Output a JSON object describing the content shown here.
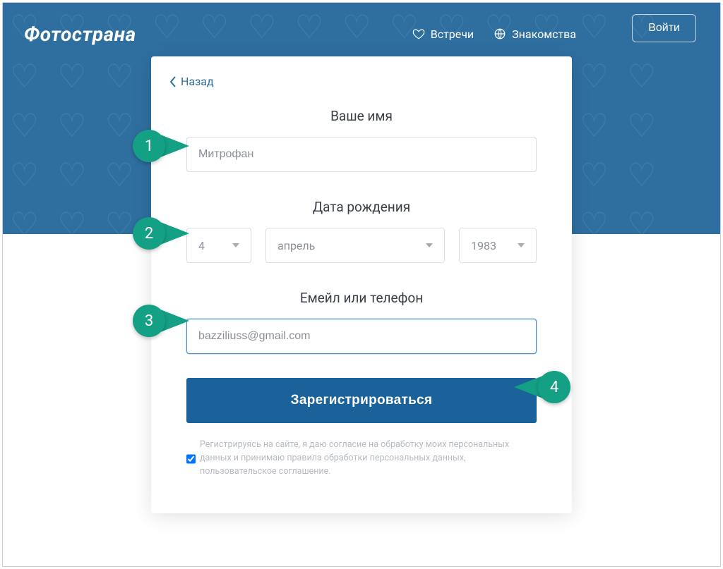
{
  "brand": "Фотострана",
  "nav": {
    "meet": "Встречи",
    "dating": "Знакомства"
  },
  "login_label": "Войти",
  "back_label": "Назад",
  "form": {
    "name_label": "Ваше имя",
    "name_value": "Митрофан",
    "dob_label": "Дата рождения",
    "day": "4",
    "month": "апрель",
    "year": "1983",
    "contact_label": "Емейл или телефон",
    "contact_value": "bazziliuss@gmail.com",
    "submit_label": "Зарегистрироваться",
    "consent_text": "Регистрируясь на сайте, я даю согласие на обработку моих персональных данных и принимаю правила обработки персональных данных, пользовательское соглашение."
  },
  "callouts": {
    "c1": "1",
    "c2": "2",
    "c3": "3",
    "c4": "4"
  }
}
